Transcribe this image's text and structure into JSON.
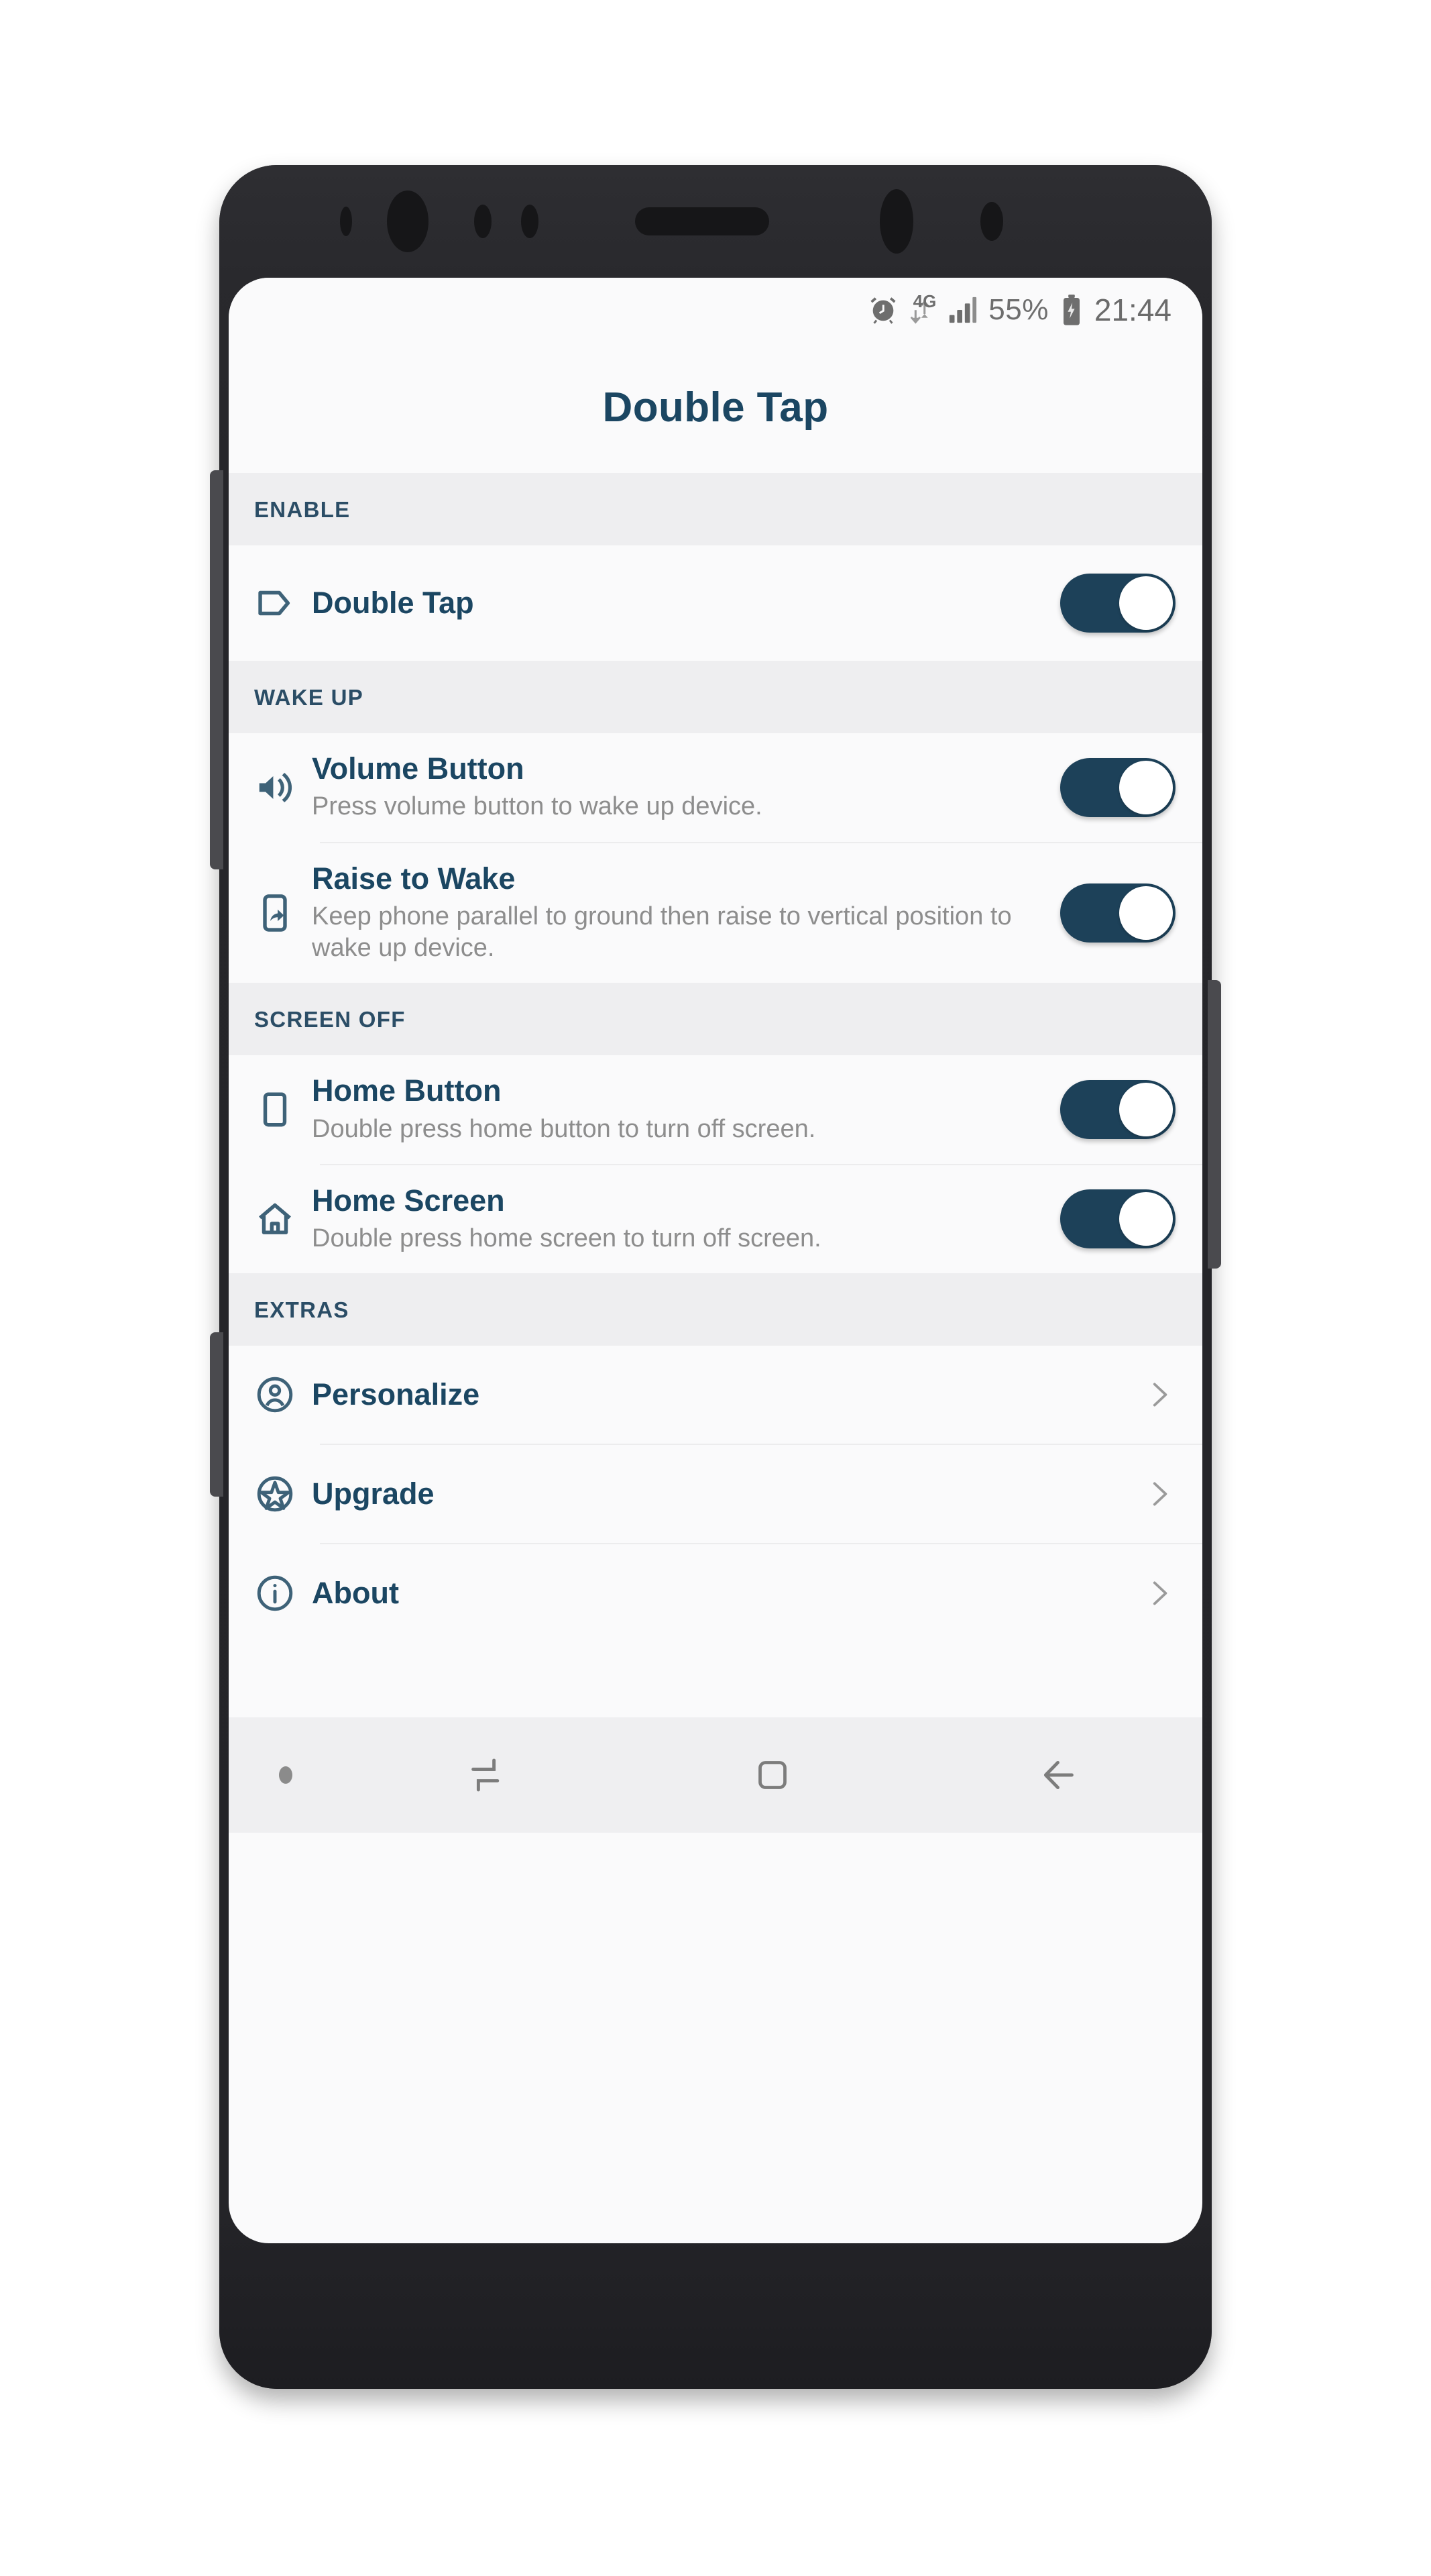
{
  "app": {
    "title": "Double Tap"
  },
  "status_bar": {
    "alarm_icon": "alarm-clock-icon",
    "network_label": "4G",
    "data_arrows_icon": "data-transfer-icon",
    "signal_icon": "signal-bars-icon",
    "battery_percent": "55%",
    "battery_icon": "battery-charging-icon",
    "clock": "21:44"
  },
  "sections": [
    {
      "header": "ENABLE",
      "rows": [
        {
          "icon": "tag-icon",
          "title": "Double Tap",
          "summary": "",
          "toggle": true,
          "toggle_state": "on"
        }
      ]
    },
    {
      "header": "WAKE UP",
      "rows": [
        {
          "icon": "volume-icon",
          "title": "Volume Button",
          "summary": "Press volume button to wake up device.",
          "toggle": true,
          "toggle_state": "on"
        },
        {
          "icon": "phone-raise-icon",
          "title": "Raise to Wake",
          "summary": "Keep phone parallel to ground then raise to vertical position to wake up device.",
          "toggle": true,
          "toggle_state": "on"
        }
      ]
    },
    {
      "header": "SCREEN OFF",
      "rows": [
        {
          "icon": "phone-outline-icon",
          "title": "Home Button",
          "summary": "Double press home button to turn off screen.",
          "toggle": true,
          "toggle_state": "on"
        },
        {
          "icon": "home-icon",
          "title": "Home Screen",
          "summary": "Double press home screen to turn off screen.",
          "toggle": true,
          "toggle_state": "on"
        }
      ]
    },
    {
      "header": "EXTRAS",
      "rows": [
        {
          "icon": "person-circle-icon",
          "title": "Personalize",
          "chevron": "chevron-right-icon"
        },
        {
          "icon": "star-circle-icon",
          "title": "Upgrade",
          "chevron": "chevron-right-icon"
        },
        {
          "icon": "info-circle-icon",
          "title": "About",
          "chevron": "chevron-right-icon"
        }
      ]
    }
  ],
  "nav_bar": {
    "keyboard_dot": "keyboard-toggle-dot-icon",
    "recents": "recents-icon",
    "home": "home-square-icon",
    "back": "back-arrow-icon"
  },
  "colors": {
    "accent": "#1b4662",
    "toggle_track": "#1d4159",
    "section_header_bg": "#eeeef0",
    "screen_bg": "#fafafb",
    "summary_text": "#8d8d8d",
    "frame": "#26262a"
  }
}
